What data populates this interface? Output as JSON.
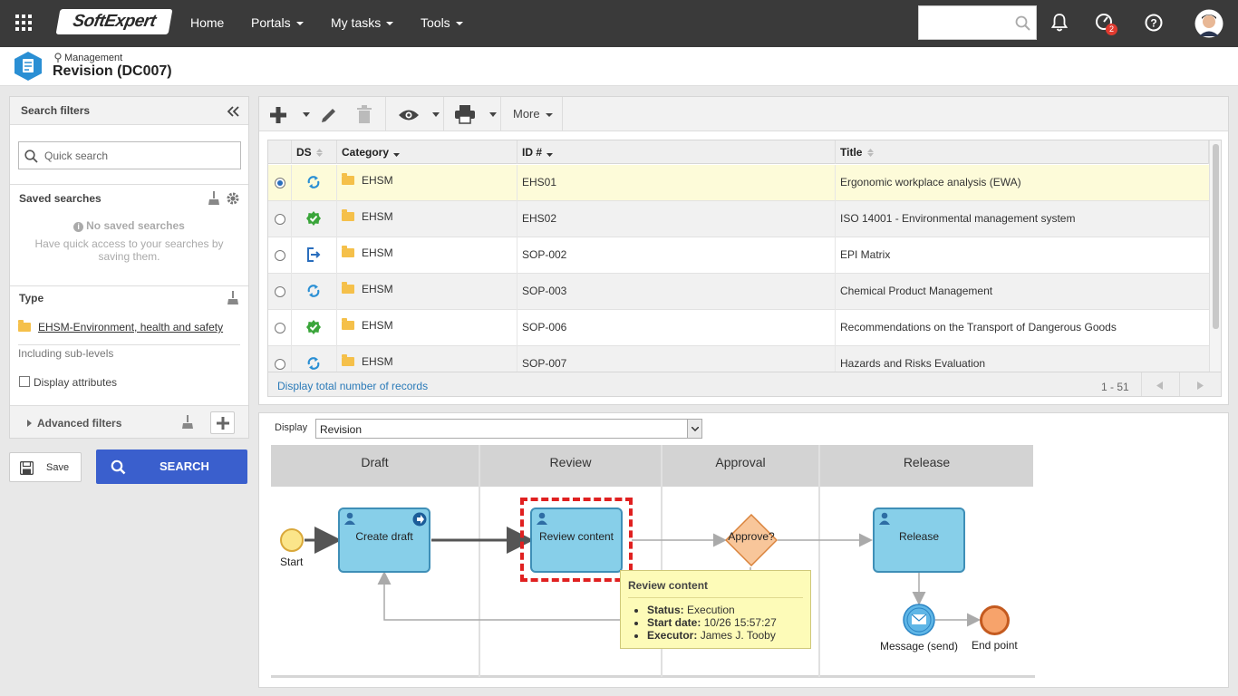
{
  "topbar": {
    "brand": "SoftExpert",
    "nav": [
      {
        "label": "Home",
        "dropdown": false
      },
      {
        "label": "Portals",
        "dropdown": true
      },
      {
        "label": "My tasks",
        "dropdown": true
      },
      {
        "label": "Tools",
        "dropdown": true
      }
    ],
    "search_placeholder": "",
    "notification_badge": "2"
  },
  "header": {
    "breadcrumb": "Management",
    "title": "Revision (DC007)"
  },
  "filters": {
    "title": "Search filters",
    "quick_search_placeholder": "Quick search",
    "saved_searches_title": "Saved searches",
    "no_saved": "No saved searches",
    "no_saved_hint": "Have quick access to your searches by saving them.",
    "type_title": "Type",
    "type_value": "EHSM-Environment, health and safety",
    "including": "Including sub-levels",
    "display_attributes": "Display attributes",
    "advanced_filters": "Advanced filters",
    "save_label": "Save",
    "search_label": "SEARCH"
  },
  "toolbar": {
    "more_label": "More"
  },
  "grid": {
    "columns": [
      "DS",
      "Category",
      "ID #",
      "Title"
    ],
    "rows": [
      {
        "status": "revision",
        "category": "EHSM",
        "id": "EHS01",
        "title": "Ergonomic workplace analysis (EWA)",
        "selected": true
      },
      {
        "status": "released",
        "category": "EHSM",
        "id": "EHS02",
        "title": "ISO 14001 - Environmental management system",
        "selected": false
      },
      {
        "status": "export",
        "category": "EHSM",
        "id": "SOP-002",
        "title": "EPI Matrix",
        "selected": false
      },
      {
        "status": "revision",
        "category": "EHSM",
        "id": "SOP-003",
        "title": "Chemical Product Management",
        "selected": false
      },
      {
        "status": "released",
        "category": "EHSM",
        "id": "SOP-006",
        "title": "Recommendations on the Transport of Dangerous Goods",
        "selected": false
      },
      {
        "status": "revision",
        "category": "EHSM",
        "id": "SOP-007",
        "title": "Hazards and Risks Evaluation",
        "selected": false
      }
    ],
    "total_link": "Display total number of records",
    "pagination": "1 - 51"
  },
  "diagram": {
    "display_label": "Display",
    "display_value": "Revision",
    "lanes": [
      "Draft",
      "Review",
      "Approval",
      "Release"
    ],
    "nodes": {
      "start": "Start",
      "create_draft": "Create draft",
      "review_content": "Review content",
      "approve": "Approve?",
      "release": "Release",
      "message": "Message (send)",
      "end": "End point"
    },
    "tooltip": {
      "title": "Review content",
      "items": [
        {
          "label": "Status:",
          "value": "Execution"
        },
        {
          "label": "Start date:",
          "value": "10/26  15:57:27"
        },
        {
          "label": "Executor:",
          "value": "James J. Tooby"
        }
      ]
    }
  },
  "colors": {
    "topbar": "#3a3a3a",
    "accent": "#3a5fcd",
    "task_fill": "#87cfe9",
    "gateway_fill": "#f8c69a",
    "selected_row": "#fdfbd9",
    "highlight_border": "#e02020"
  }
}
